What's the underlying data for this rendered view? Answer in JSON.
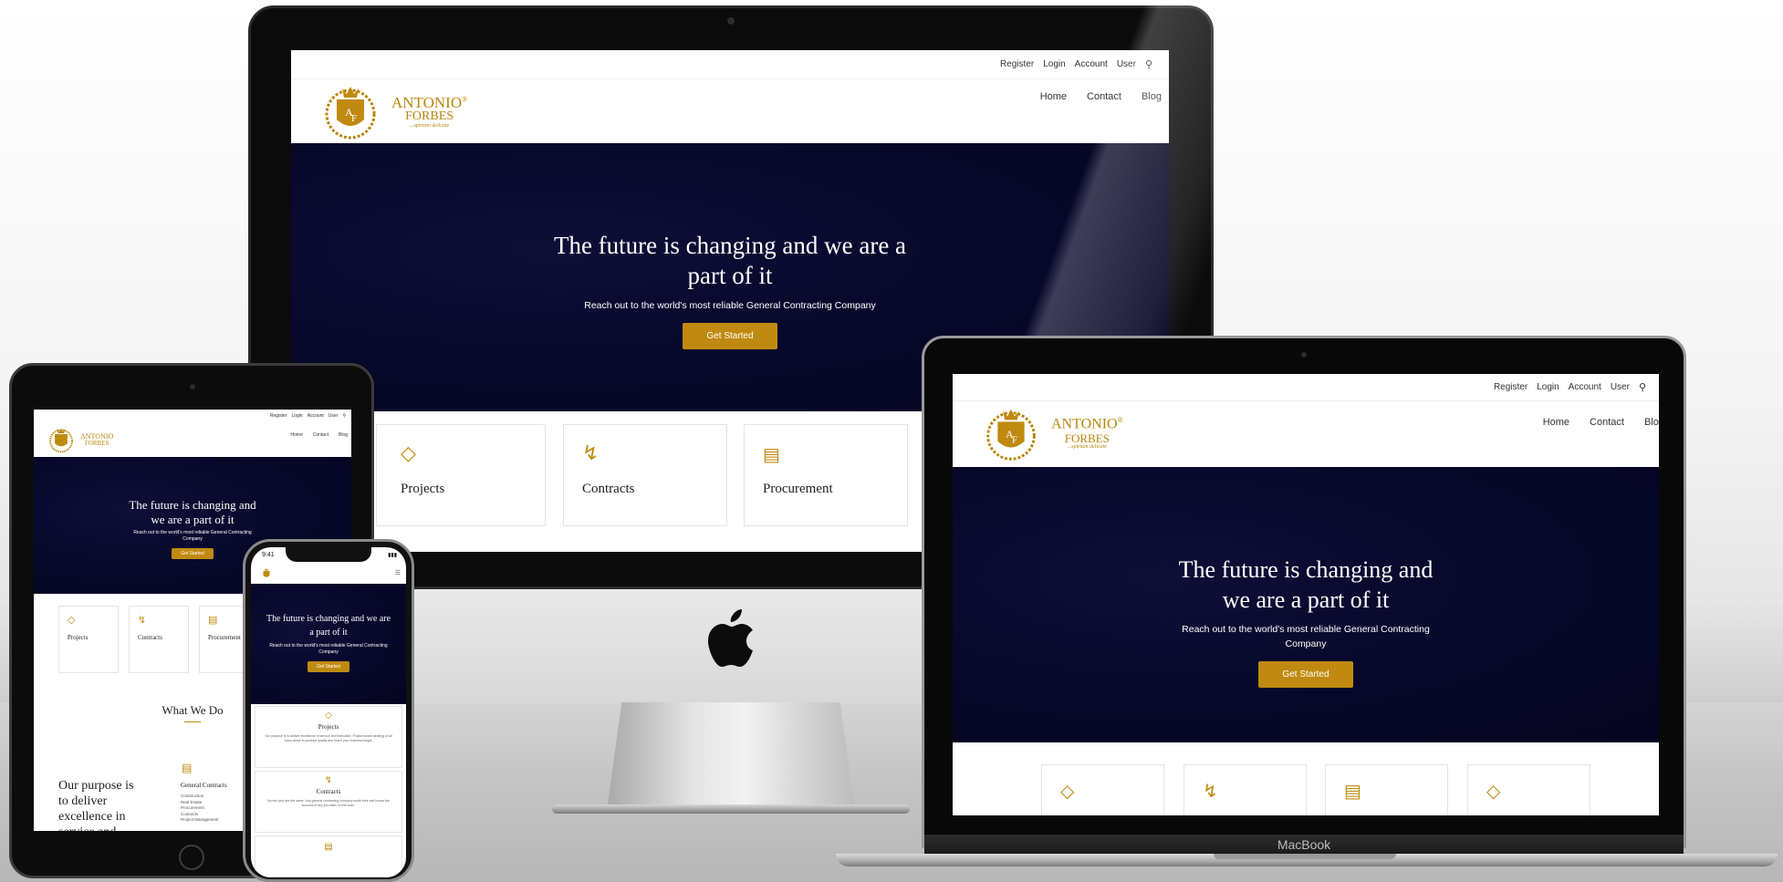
{
  "site": {
    "topbar": [
      "Register",
      "Login",
      "Account",
      "User"
    ],
    "nav": [
      "Home",
      "Contact",
      "Blog"
    ],
    "logo": {
      "line1": "ANTONIO",
      "line2": "FORBES",
      "tagline": "...spirtum delicate",
      "mark": "®"
    },
    "hero": {
      "title": "The future is changing and we are a part of it",
      "subtitle": "Reach out to the world's most reliable General Contracting Company",
      "cta": "Get Started"
    },
    "cards": [
      {
        "title": "Projects",
        "icon": "diamond-icon"
      },
      {
        "title": "Contracts",
        "icon": "bolt-icon"
      },
      {
        "title": "Procurement",
        "icon": "laptop-icon"
      }
    ],
    "what_we_do": "What We Do",
    "purpose": "Our purpose is to deliver excellence in service and",
    "general_contracts": {
      "title": "General Contracts",
      "items": [
        "Construction",
        "Real Estate",
        "Procurement",
        "Contracts",
        "Project Management"
      ]
    },
    "phone_cards": [
      {
        "title": "Projects",
        "text": "Our purpose is to deliver excellence in service and execution. Project based strategy of all focus areas to produce quality and reach your business target."
      },
      {
        "title": "Contracts",
        "text": "No two jobs are the same. Any general contracting company worth their salt knows the success of any job relies on the team."
      }
    ]
  },
  "phone_status": {
    "time": "9:41"
  },
  "macbook_label": "MacBook",
  "colors": {
    "gold": "#c08a10",
    "navy": "#07072a"
  }
}
